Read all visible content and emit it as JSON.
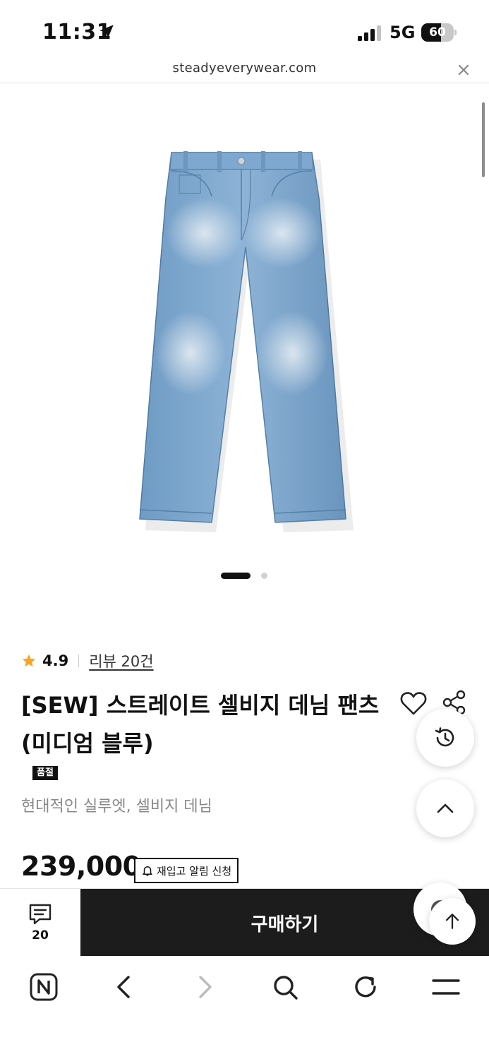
{
  "status_bar": {
    "time": "11:31",
    "network": "5G",
    "battery": 60
  },
  "browser": {
    "url": "steadyeverywear.com"
  },
  "product": {
    "rating": "4.9",
    "review_link": "리뷰 20건",
    "title_line1": "[SEW] 스트레이트 셀비지 데님 팬츠",
    "title_line2": "(미디엄 블루)",
    "badge": "품절",
    "subtitle": "현대적인 실루엣, 셀비지 데님",
    "price": "239,000",
    "restock_label": "재입고 알림 신청"
  },
  "purchase_bar": {
    "review_count": "20",
    "buy_label": "구매하기"
  },
  "icons": {
    "location": "location-arrow-icon",
    "star": "star-icon",
    "heart": "heart-icon",
    "share": "share-icon",
    "history": "history-icon",
    "scroll_up": "chevron-up-icon",
    "to_top": "arrow-up-icon",
    "chat": "chat-icon",
    "bell": "bell-icon"
  },
  "colors": {
    "star": "#f5a623",
    "buy_button": "#1c1c1c",
    "denim": "#7fa7cc"
  },
  "carousel": {
    "total": 2,
    "active": 1
  }
}
